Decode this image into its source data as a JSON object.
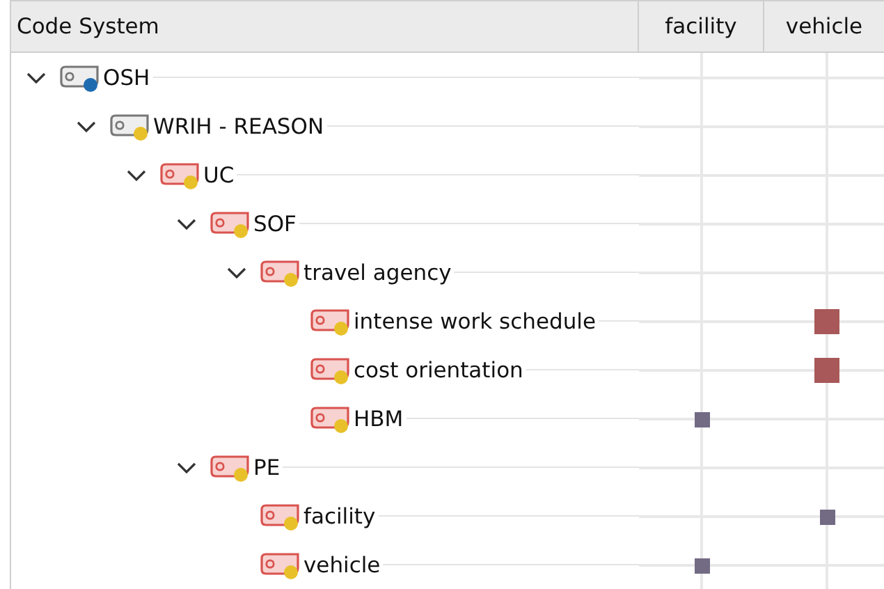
{
  "header": {
    "title": "Code System",
    "columns": [
      "facility",
      "vehicle"
    ]
  },
  "tree": [
    {
      "name": "OSH",
      "kind": "category",
      "color": "#1f6bb0",
      "expanded": true,
      "cells": [
        null,
        null
      ],
      "children": [
        {
          "name": "WRIH - REASON",
          "kind": "category",
          "color": "#e8c12a",
          "expanded": true,
          "cells": [
            null,
            null
          ],
          "children": [
            {
              "name": "UC",
              "kind": "code",
              "color": "#e8c12a",
              "expanded": true,
              "cells": [
                null,
                null
              ],
              "children": [
                {
                  "name": "SOF",
                  "kind": "code",
                  "color": "#e8c12a",
                  "expanded": true,
                  "cells": [
                    null,
                    null
                  ],
                  "children": [
                    {
                      "name": "travel agency",
                      "kind": "code",
                      "color": "#e8c12a",
                      "expanded": true,
                      "cells": [
                        null,
                        null
                      ],
                      "children": [
                        {
                          "name": "intense work schedule",
                          "kind": "code",
                          "color": "#e8c12a",
                          "cells": [
                            null,
                            {
                              "kind": "large",
                              "color": "#a85858"
                            }
                          ]
                        },
                        {
                          "name": "cost orientation",
                          "kind": "code",
                          "color": "#e8c12a",
                          "cells": [
                            null,
                            {
                              "kind": "large",
                              "color": "#a85858"
                            }
                          ]
                        },
                        {
                          "name": "HBM",
                          "kind": "code",
                          "color": "#e8c12a",
                          "cells": [
                            {
                              "kind": "small",
                              "color": "#736a84"
                            },
                            null
                          ]
                        }
                      ]
                    }
                  ]
                },
                {
                  "name": "PE",
                  "kind": "code",
                  "color": "#e8c12a",
                  "expanded": true,
                  "cells": [
                    null,
                    null
                  ],
                  "children": [
                    {
                      "name": "facility",
                      "kind": "code",
                      "color": "#e8c12a",
                      "cells": [
                        null,
                        {
                          "kind": "small",
                          "color": "#736a84"
                        }
                      ]
                    },
                    {
                      "name": "vehicle",
                      "kind": "code",
                      "color": "#e8c12a",
                      "cells": [
                        {
                          "kind": "small",
                          "color": "#736a84"
                        },
                        null
                      ]
                    }
                  ]
                }
              ]
            }
          ]
        }
      ]
    }
  ]
}
